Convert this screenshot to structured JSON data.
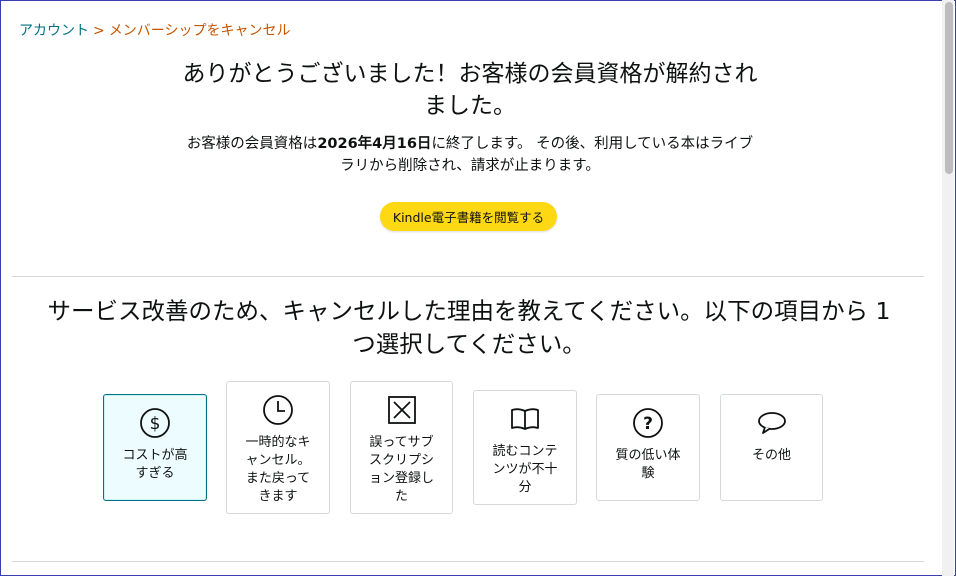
{
  "breadcrumb": {
    "account": "アカウント",
    "separator": ">",
    "current": "メンバーシップをキャンセル"
  },
  "heading": {
    "line1": "ありがとうございました！お客様の会員資格が解約され",
    "line2": "ました。"
  },
  "subtext": {
    "prefix": "お客様の会員資格は",
    "date": "2026年4月16日",
    "middle": "に終了します。 その後、利用している本はライブ",
    "line2": "ラリから削除され、請求が止まります。"
  },
  "kindle_button": {
    "label": "Kindle電子書籍を閲覧する"
  },
  "survey": {
    "question_line1": "サービス改善のため、キャンセルした理由を教えてください。以下の項目から 1",
    "question_line2": "つ選択してください。",
    "options": [
      {
        "label": "コストが高\nすぎる",
        "icon": "dollar-circle-icon",
        "selected": true
      },
      {
        "label": "一時的なキ\nャンセル。\nまた戻って\nきます",
        "icon": "clock-icon",
        "selected": false
      },
      {
        "label": "誤ってサブ\nスクリプシ\nョン登録し\nた",
        "icon": "x-box-icon",
        "selected": false
      },
      {
        "label": "読むコンテ\nンツが不十\n分",
        "icon": "book-icon",
        "selected": false
      },
      {
        "label": "質の低い体\n験",
        "icon": "question-circle-icon",
        "selected": false
      },
      {
        "label": "その他",
        "icon": "speech-bubble-icon",
        "selected": false
      }
    ]
  },
  "colors": {
    "link": "#007185",
    "breadcrumb_current": "#c45500",
    "button_yellow": "#ffd814",
    "selected_border": "#007185",
    "selected_bg": "#edfdff"
  }
}
